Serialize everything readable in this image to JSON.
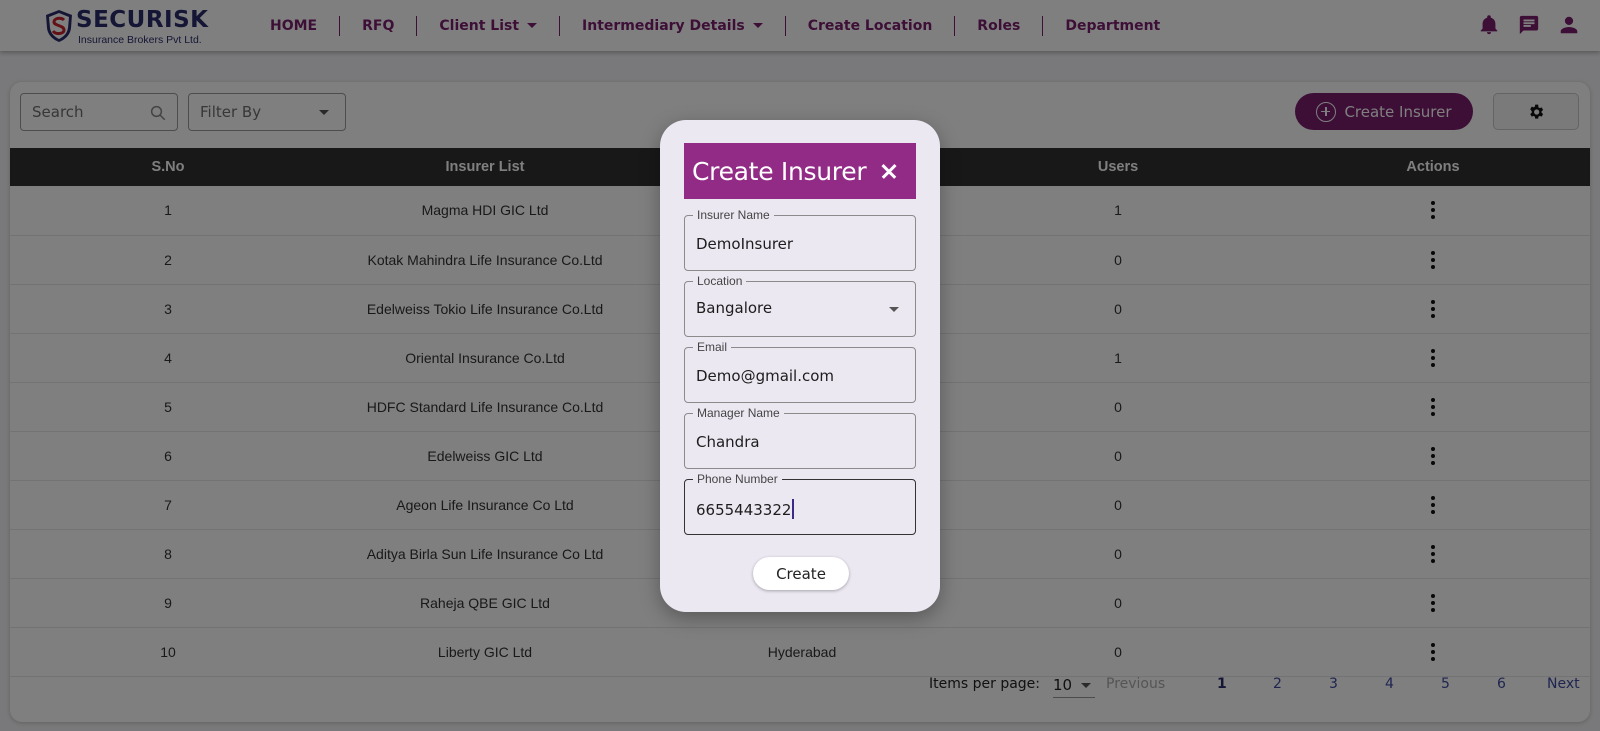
{
  "brand": {
    "name": "SECURISK",
    "tagline": "Insurance Brokers Pvt Ltd."
  },
  "nav": {
    "items": [
      {
        "label": "HOME",
        "dropdown": false
      },
      {
        "label": "RFQ",
        "dropdown": false
      },
      {
        "label": "Client List",
        "dropdown": true
      },
      {
        "label": "Intermediary Details",
        "dropdown": true
      },
      {
        "label": "Create Location",
        "dropdown": false
      },
      {
        "label": "Roles",
        "dropdown": false
      },
      {
        "label": "Department",
        "dropdown": false
      }
    ],
    "icons": [
      "bell-icon",
      "chat-icon",
      "user-icon"
    ]
  },
  "toolbar": {
    "search_placeholder": "Search",
    "filter_placeholder": "Filter By",
    "create_insurer_label": "Create Insurer",
    "settings_icon": "gear-icon"
  },
  "table": {
    "headers": [
      "S.No",
      "Insurer List",
      "",
      "Users",
      "Actions"
    ],
    "rows": [
      {
        "sno": "1",
        "insurer": "Magma HDI GIC Ltd",
        "location": "",
        "users": "1"
      },
      {
        "sno": "2",
        "insurer": "Kotak Mahindra Life Insurance Co.Ltd",
        "location": "",
        "users": "0"
      },
      {
        "sno": "3",
        "insurer": "Edelweiss Tokio Life Insurance Co.Ltd",
        "location": "",
        "users": "0"
      },
      {
        "sno": "4",
        "insurer": "Oriental Insurance Co.Ltd",
        "location": "",
        "users": "1"
      },
      {
        "sno": "5",
        "insurer": "HDFC Standard Life Insurance Co.Ltd",
        "location": "",
        "users": "0"
      },
      {
        "sno": "6",
        "insurer": "Edelweiss GIC Ltd",
        "location": "",
        "users": "0"
      },
      {
        "sno": "7",
        "insurer": "Ageon Life Insurance Co Ltd",
        "location": "",
        "users": "0"
      },
      {
        "sno": "8",
        "insurer": "Aditya Birla Sun Life Insurance Co Ltd",
        "location": "",
        "users": "0"
      },
      {
        "sno": "9",
        "insurer": "Raheja QBE GIC Ltd",
        "location": "",
        "users": "0"
      },
      {
        "sno": "10",
        "insurer": "Liberty GIC Ltd",
        "location": "Hyderabad",
        "users": "0"
      }
    ]
  },
  "pagination": {
    "items_per_page_label": "Items per page:",
    "items_per_page": "10",
    "previous": "Previous",
    "pages": [
      "1",
      "2",
      "3",
      "4",
      "5",
      "6"
    ],
    "active_page": "1",
    "next": "Next"
  },
  "modal": {
    "title": "Create Insurer",
    "fields": [
      {
        "label": "Insurer Name",
        "value": "DemoInsurer",
        "type": "text"
      },
      {
        "label": "Location",
        "value": "Bangalore",
        "type": "select"
      },
      {
        "label": "Email",
        "value": "Demo@gmail.com",
        "type": "text"
      },
      {
        "label": "Manager Name",
        "value": "Chandra",
        "type": "text"
      },
      {
        "label": "Phone Number",
        "value": "6655443322",
        "type": "text"
      }
    ],
    "submit_label": "Create"
  }
}
